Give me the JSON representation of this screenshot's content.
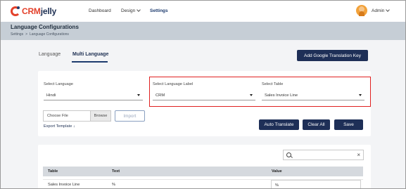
{
  "app": {
    "logo_crm": "CRM",
    "logo_jelly": "jelly"
  },
  "nav": {
    "items": [
      {
        "label": "Dashboard"
      },
      {
        "label": "Design"
      },
      {
        "label": "Settings"
      }
    ],
    "user": "Admin"
  },
  "header": {
    "title": "Language Configurations",
    "breadcrumb": [
      "Settings",
      ">",
      "Language Configurations"
    ]
  },
  "tabs": [
    {
      "label": "Language",
      "active": false
    },
    {
      "label": "Multi Language",
      "active": true
    }
  ],
  "actions": {
    "add_google_key": "Add Google Translation Key",
    "auto_translate": "Auto Translate",
    "clear_all": "Clear All",
    "save": "Save"
  },
  "form": {
    "select_language": {
      "label": "Select Language",
      "value": "Hindi"
    },
    "select_language_label": {
      "label": "Select Language Label",
      "value": "CRM"
    },
    "select_table": {
      "label": "Select Table",
      "value": "Sales Invoice Line"
    },
    "file": {
      "placeholder": "Choose File",
      "browse": "Browse"
    },
    "import": "Import",
    "export_template": "Export Template ↓"
  },
  "table": {
    "headers": [
      "Table",
      "Text",
      "Value"
    ],
    "rows": [
      {
        "table": "Sales Invoice Line",
        "text": "%",
        "value": "%"
      }
    ]
  },
  "colors": {
    "primary": "#1e2f57",
    "highlight": "#e02020",
    "band": "#c6ced6",
    "brand_red": "#e3412b"
  }
}
